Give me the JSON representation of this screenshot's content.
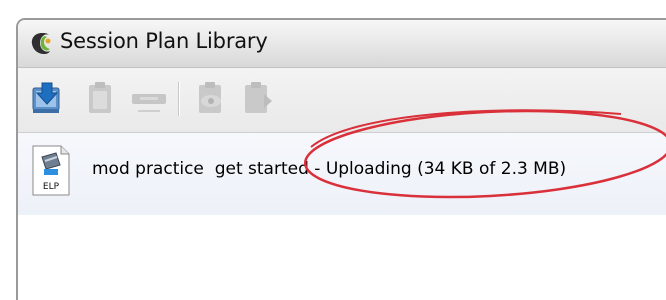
{
  "window": {
    "title": "Session Plan Library"
  },
  "toolbar": {
    "buttons": [
      {
        "icon": "download-icon",
        "enabled": true
      },
      {
        "icon": "clipboard-icon",
        "enabled": false
      },
      {
        "icon": "remove-icon",
        "enabled": false
      },
      {
        "icon": "preview-icon",
        "enabled": false
      },
      {
        "icon": "launch-icon",
        "enabled": false
      }
    ]
  },
  "library": {
    "items": [
      {
        "file_type": "ELP",
        "name": "mod practice  get started",
        "status": " - Uploading (34 KB of 2.3 MB)"
      }
    ]
  },
  "annotation": {
    "color": "#d9303a"
  }
}
